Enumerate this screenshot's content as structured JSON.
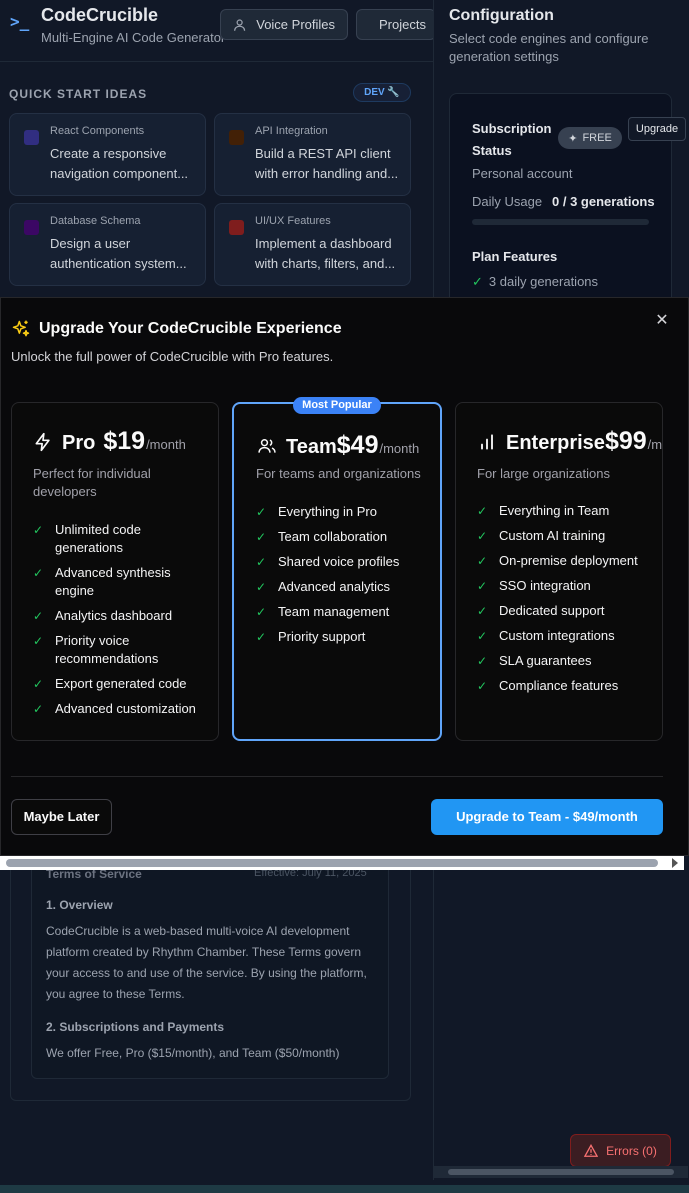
{
  "app": {
    "title": "CodeCrucible",
    "subtitle": "Multi-Engine AI Code Generator",
    "voice_profiles_label": "Voice Profiles",
    "projects_label": "Projects"
  },
  "quick_start": {
    "title": "QUICK START IDEAS",
    "dev_badge": "DEV 🔧",
    "cards": [
      {
        "category": "React Components",
        "description": "Create a responsive navigation component...",
        "icon": "atom-icon",
        "color": "#6366f1"
      },
      {
        "category": "API Integration",
        "description": "Build a REST API client with error handling and...",
        "icon": "plug-icon",
        "color": "#a16207"
      },
      {
        "category": "Database Schema",
        "description": "Design a user authentication system...",
        "icon": "database-icon",
        "color": "#7c3aed"
      },
      {
        "category": "UI/UX Features",
        "description": "Implement a dashboard with charts, filters, and...",
        "icon": "chart-icon",
        "color": "#dc2626"
      }
    ]
  },
  "config": {
    "title": "Configuration",
    "subtitle": "Select code engines and configure generation settings",
    "subscription_title": "Subscription Status",
    "free_badge": "FREE",
    "upgrade_label": "Upgrade",
    "account": "Personal account",
    "usage_label": "Daily Usage",
    "usage_value": "0 / 3 generations",
    "usage_fraction": 0,
    "plan_features_title": "Plan Features",
    "plan_feature": "3 daily generations"
  },
  "terms": {
    "title": "Terms of Service",
    "effective": "Effective: July 11, 2025",
    "h1": "1. Overview",
    "p1": "CodeCrucible is a web-based multi-voice AI development platform created by Rhythm Chamber. These Terms govern your access to and use of the service. By using the platform, you agree to these Terms.",
    "h2": "2. Subscriptions and Payments",
    "p2": "We offer Free, Pro ($15/month), and Team ($50/month)"
  },
  "errors_label": "Errors (0)",
  "modal": {
    "title": "Upgrade Your CodeCrucible Experience",
    "subtitle": "Unlock the full power of CodeCrucible with Pro features.",
    "popular_badge": "Most Popular",
    "plans": [
      {
        "name": "Pro",
        "price": "$19",
        "per": "/month",
        "icon": "lightning-icon",
        "description": "Perfect for individual developers",
        "features": [
          "Unlimited code generations",
          "Advanced synthesis engine",
          "Analytics dashboard",
          "Priority voice recommendations",
          "Export generated code",
          "Advanced customization"
        ]
      },
      {
        "name": "Team",
        "price": "$49",
        "per": "/month",
        "icon": "users-icon",
        "description": "For teams and organizations",
        "features": [
          "Everything in Pro",
          "Team collaboration",
          "Shared voice profiles",
          "Advanced analytics",
          "Team management",
          "Priority support"
        ]
      },
      {
        "name": "Enterprise",
        "price": "$99",
        "per": "/month",
        "icon": "bar-chart-icon",
        "description": "For large organizations",
        "features": [
          "Everything in Team",
          "Custom AI training",
          "On-premise deployment",
          "SSO integration",
          "Dedicated support",
          "Custom integrations",
          "SLA guarantees",
          "Compliance features"
        ]
      }
    ],
    "maybe_later": "Maybe Later",
    "upgrade_cta": "Upgrade to Team - $49/month"
  }
}
